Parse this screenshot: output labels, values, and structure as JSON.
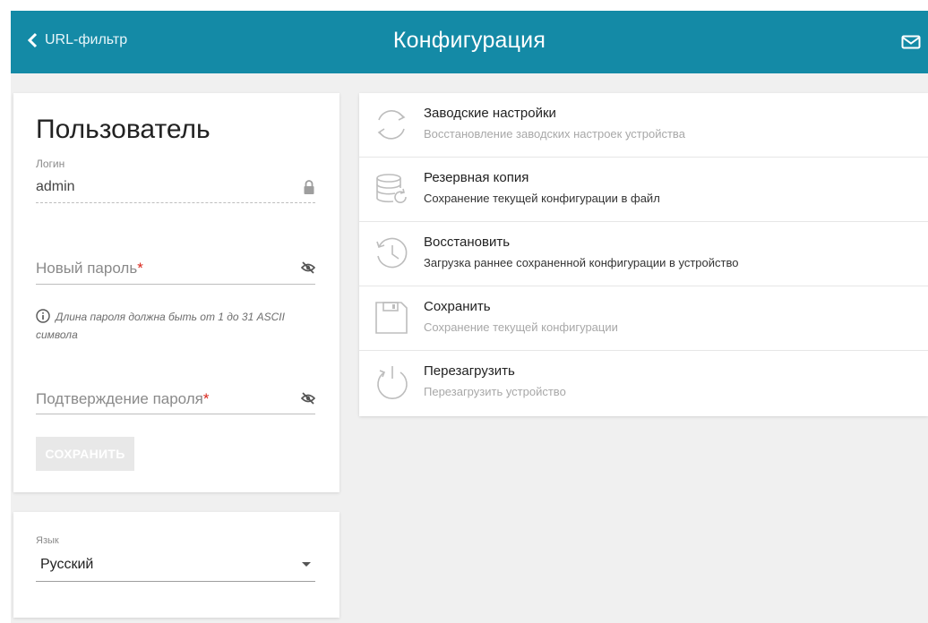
{
  "header": {
    "back_label": "URL-фильтр",
    "title": "Конфигурация",
    "bg_color": "#148aa6"
  },
  "user": {
    "title": "Пользователь",
    "login_label": "Логин",
    "login_value": "admin",
    "new_password_placeholder": "Новый пароль",
    "password_hint": "Длина пароля должна быть от 1 до 31 ASCII символа",
    "confirm_password_placeholder": "Подтверждение пароля",
    "required_mark": "*",
    "save_button": "СОХРАНИТЬ"
  },
  "language": {
    "label": "Язык",
    "value": "Русский"
  },
  "menu": {
    "items": [
      {
        "title": "Заводские настройки",
        "subtitle": "Восстановление заводских настроек устройства",
        "icon": "factory-reset-icon"
      },
      {
        "title": "Резервная копия",
        "subtitle": "Сохранение текущей конфигурации в файл",
        "icon": "backup-database-icon"
      },
      {
        "title": "Восстановить",
        "subtitle": "Загрузка раннее сохраненной конфигурации в устройство",
        "icon": "restore-history-icon"
      },
      {
        "title": "Сохранить",
        "subtitle": "Сохранение текущей конфигурации",
        "icon": "save-floppy-icon"
      },
      {
        "title": "Перезагрузить",
        "subtitle": "Перезагрузить устройство",
        "icon": "reboot-power-icon"
      }
    ]
  }
}
